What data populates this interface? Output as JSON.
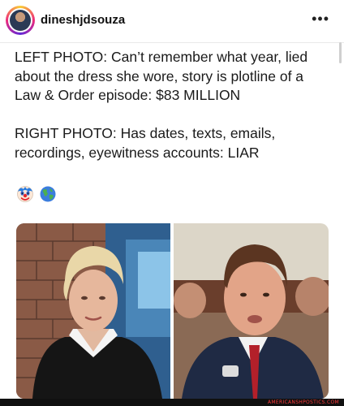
{
  "post": {
    "username": "dineshjdsouza",
    "more_label": "•••",
    "caption_paragraphs": [
      "LEFT PHOTO: Can’t remember what year, lied about the dress she wore, story is plotline of a Law & Order episode: $83 MILLION",
      "RIGHT PHOTO: Has dates, texts, emails, recordings, eyewitness accounts: LIAR"
    ],
    "emojis": [
      "clown-face-icon",
      "globe-icon"
    ]
  },
  "watermark": "AMERICANSHPOSTICS.COM",
  "colors": {
    "text": "#1a1a1a",
    "divider": "#e9e9e9",
    "watermark": "#ff3b3b"
  }
}
